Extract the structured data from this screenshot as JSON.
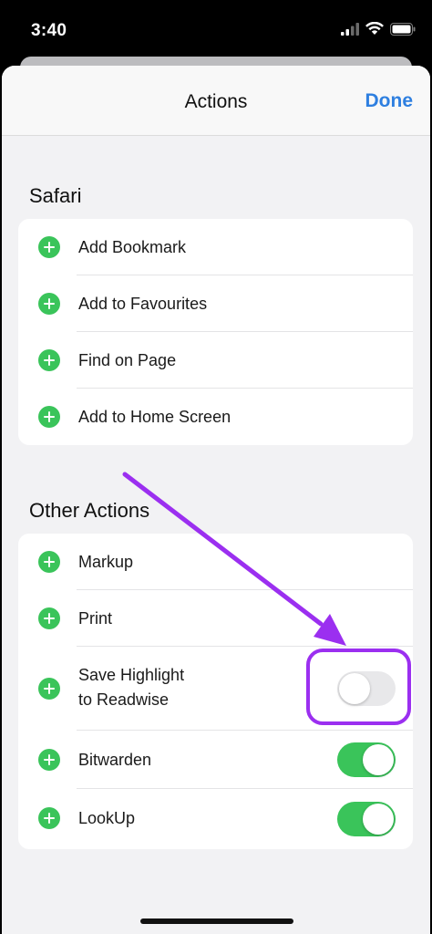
{
  "status_bar": {
    "time": "3:40"
  },
  "nav": {
    "title": "Actions",
    "done_label": "Done"
  },
  "sections": [
    {
      "header": "Safari",
      "rows": [
        {
          "label": "Add Bookmark"
        },
        {
          "label": "Add to Favourites"
        },
        {
          "label": "Find on Page"
        },
        {
          "label": "Add to Home Screen"
        }
      ]
    },
    {
      "header": "Other Actions",
      "rows": [
        {
          "label": "Markup"
        },
        {
          "label": "Print"
        },
        {
          "label": "Save Highlight",
          "label_line2": "to Readwise",
          "toggle": "off"
        },
        {
          "label": "Bitwarden",
          "toggle": "on"
        },
        {
          "label": "LookUp",
          "toggle": "on"
        }
      ]
    }
  ],
  "colors": {
    "accent_blue": "#2e7fe0",
    "toggle_green": "#3ac45a",
    "annotation_purple": "#9b2ff0"
  },
  "icons": {
    "add": "plus-circle-icon",
    "signal": "cellular-signal-icon",
    "wifi": "wifi-icon",
    "battery": "battery-icon"
  }
}
